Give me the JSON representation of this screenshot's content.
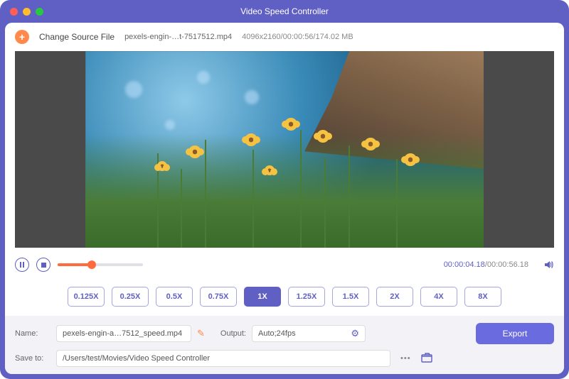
{
  "window": {
    "title": "Video Speed Controller"
  },
  "toolbar": {
    "change_source": "Change Source File",
    "filename": "pexels-engin-…t-7517512.mp4",
    "info": "4096x2160/00:00:56/174.02 MB"
  },
  "playback": {
    "current": "00:00:04.18",
    "duration": "00:00:56.18"
  },
  "speeds": [
    "0.125X",
    "0.25X",
    "0.5X",
    "0.75X",
    "1X",
    "1.25X",
    "1.5X",
    "2X",
    "4X",
    "8X"
  ],
  "speed_active": "1X",
  "output": {
    "name_label": "Name:",
    "name_value": "pexels-engin-a…7512_speed.mp4",
    "output_label": "Output:",
    "output_value": "Auto;24fps",
    "save_label": "Save to:",
    "save_value": "/Users/test/Movies/Video Speed Controller",
    "export": "Export"
  }
}
